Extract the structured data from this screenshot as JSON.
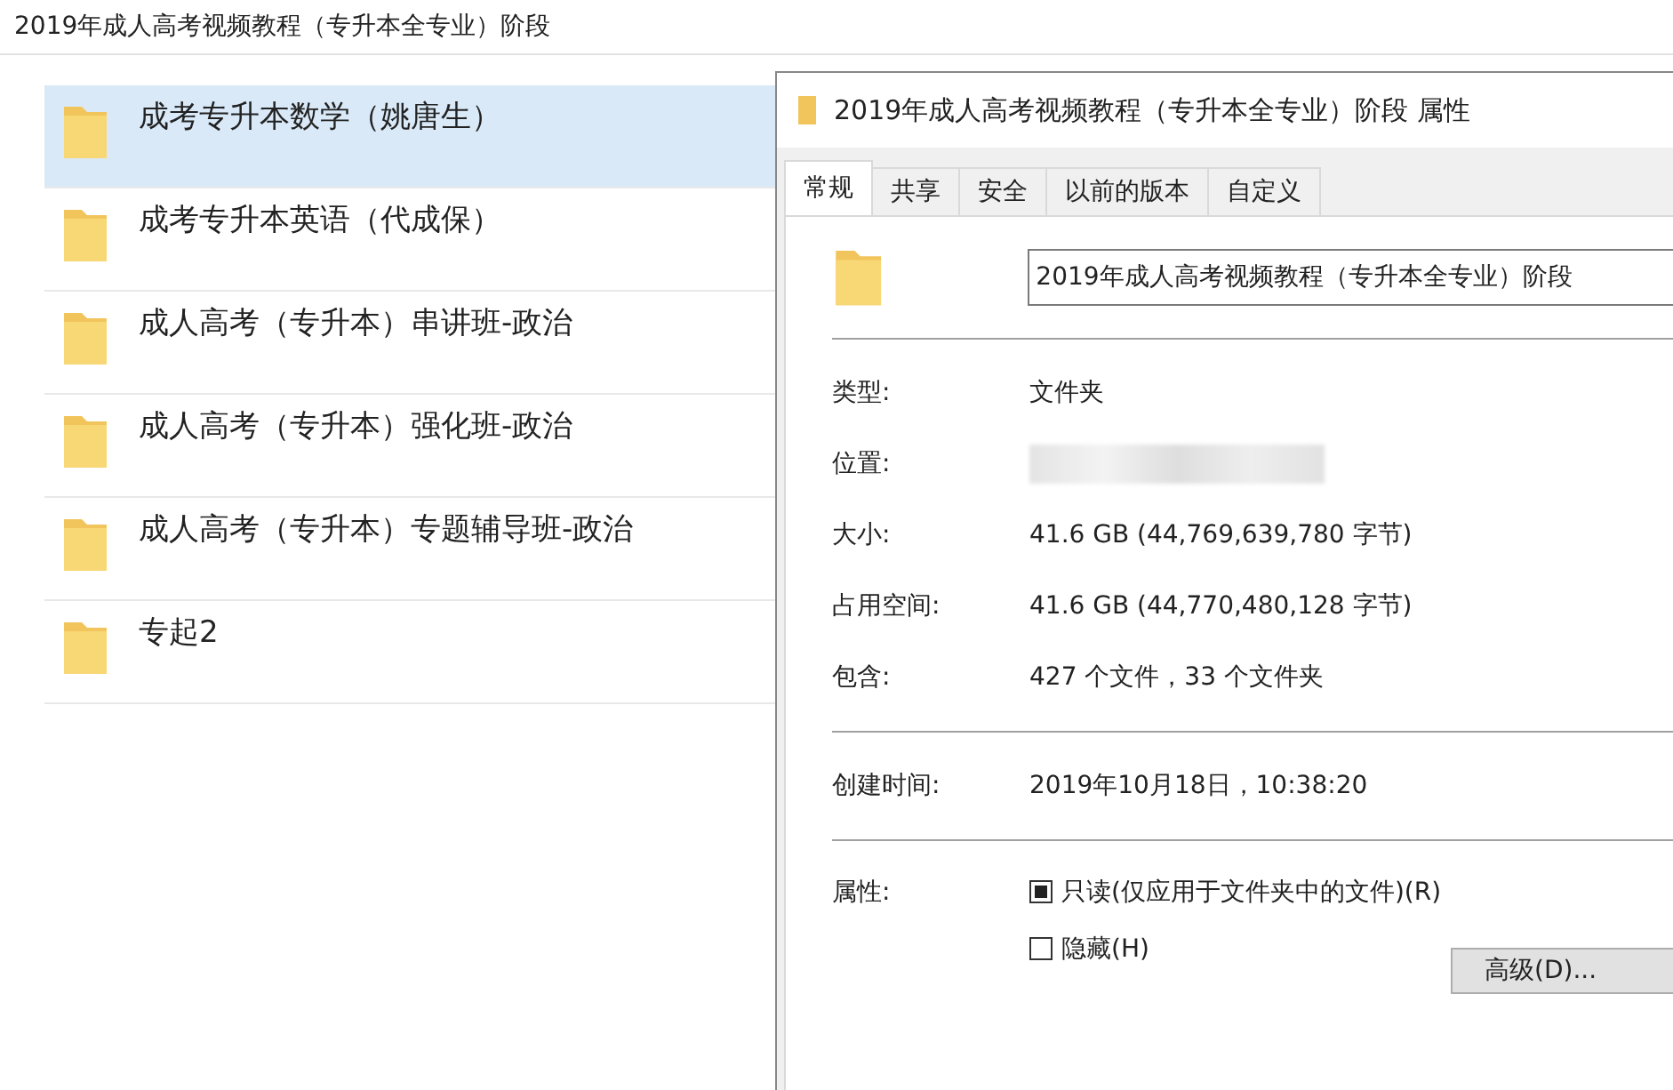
{
  "explorer": {
    "path": "2019年成人高考视频教程（专升本全专业）阶段",
    "items": [
      {
        "name": "成考专升本数学（姚唐生）",
        "selected": true
      },
      {
        "name": "成考专升本英语（代成保）",
        "selected": false
      },
      {
        "name": "成人高考（专升本）串讲班-政治",
        "selected": false
      },
      {
        "name": "成人高考（专升本）强化班-政治",
        "selected": false
      },
      {
        "name": "成人高考（专升本）专题辅导班-政治",
        "selected": false
      },
      {
        "name": "专起2",
        "selected": false
      }
    ]
  },
  "dialog": {
    "title": "2019年成人高考视频教程（专升本全专业）阶段 属性",
    "tabs": [
      {
        "label": "常规",
        "selected": true
      },
      {
        "label": "共享",
        "selected": false
      },
      {
        "label": "安全",
        "selected": false
      },
      {
        "label": "以前的版本",
        "selected": false
      },
      {
        "label": "自定义",
        "selected": false
      }
    ],
    "name_field": "2019年成人高考视频教程（专升本全专业）阶段",
    "sections": [
      [
        {
          "label": "类型:",
          "value": "文件夹",
          "kind": "text"
        },
        {
          "label": "位置:",
          "kind": "blurred"
        },
        {
          "label": "大小:",
          "value": "41.6 GB (44,769,639,780 字节)",
          "kind": "text"
        },
        {
          "label": "占用空间:",
          "value": "41.6 GB (44,770,480,128 字节)",
          "kind": "text"
        },
        {
          "label": "包含:",
          "value": "427 个文件，33 个文件夹",
          "kind": "text"
        }
      ],
      [
        {
          "label": "创建时间:",
          "value": "2019年10月18日，10:38:20",
          "kind": "text"
        }
      ]
    ],
    "attributes_label": "属性:",
    "attributes": [
      {
        "label": "只读(仅应用于文件夹中的文件)(R)",
        "checked": false,
        "indeterminate": true
      },
      {
        "label": "隐藏(H)",
        "checked": false,
        "indeterminate": false
      }
    ],
    "advanced_button": "高级(D)..."
  }
}
